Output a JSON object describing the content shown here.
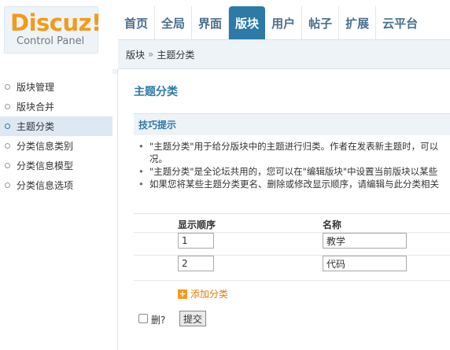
{
  "logo": {
    "title": "Discuz!",
    "subtitle": "Control Panel"
  },
  "nav": {
    "items": [
      {
        "label": "首页"
      },
      {
        "label": "全局"
      },
      {
        "label": "界面"
      },
      {
        "label": "版块",
        "active": true
      },
      {
        "label": "用户"
      },
      {
        "label": "帖子"
      },
      {
        "label": "扩展"
      },
      {
        "label": "云平台"
      }
    ]
  },
  "breadcrumb": {
    "parent": "版块",
    "separator": "»",
    "current": "主题分类"
  },
  "sidebar": {
    "items": [
      {
        "label": "版块管理"
      },
      {
        "label": "版块合并"
      },
      {
        "label": "主题分类",
        "active": true
      },
      {
        "label": "分类信息类别"
      },
      {
        "label": "分类信息模型"
      },
      {
        "label": "分类信息选项"
      }
    ]
  },
  "main": {
    "title": "主题分类",
    "tips_heading": "技巧提示",
    "tips": [
      "\"主题分类\"用于给分版块中的主题进行归类。作者在发表新主题时，可以",
      "况。",
      "\"主题分类\"是全论坛共用的，您可以在\"编辑版块\"中设置当前版块以某些",
      "如果您将某些主题分类更名、删除或修改显示顺序，请编辑与此分类相关"
    ],
    "columns": {
      "order": "显示顺序",
      "name": "名称"
    },
    "rows": [
      {
        "order": "1",
        "name": "教学"
      },
      {
        "order": "2",
        "name": "代码"
      }
    ],
    "add_label": "添加分类",
    "delete_label": "删?",
    "submit_label": "提交"
  },
  "colors": {
    "accent": "#2c7aa6",
    "brand": "#f29b1a",
    "link_orange": "#ec7b00"
  }
}
